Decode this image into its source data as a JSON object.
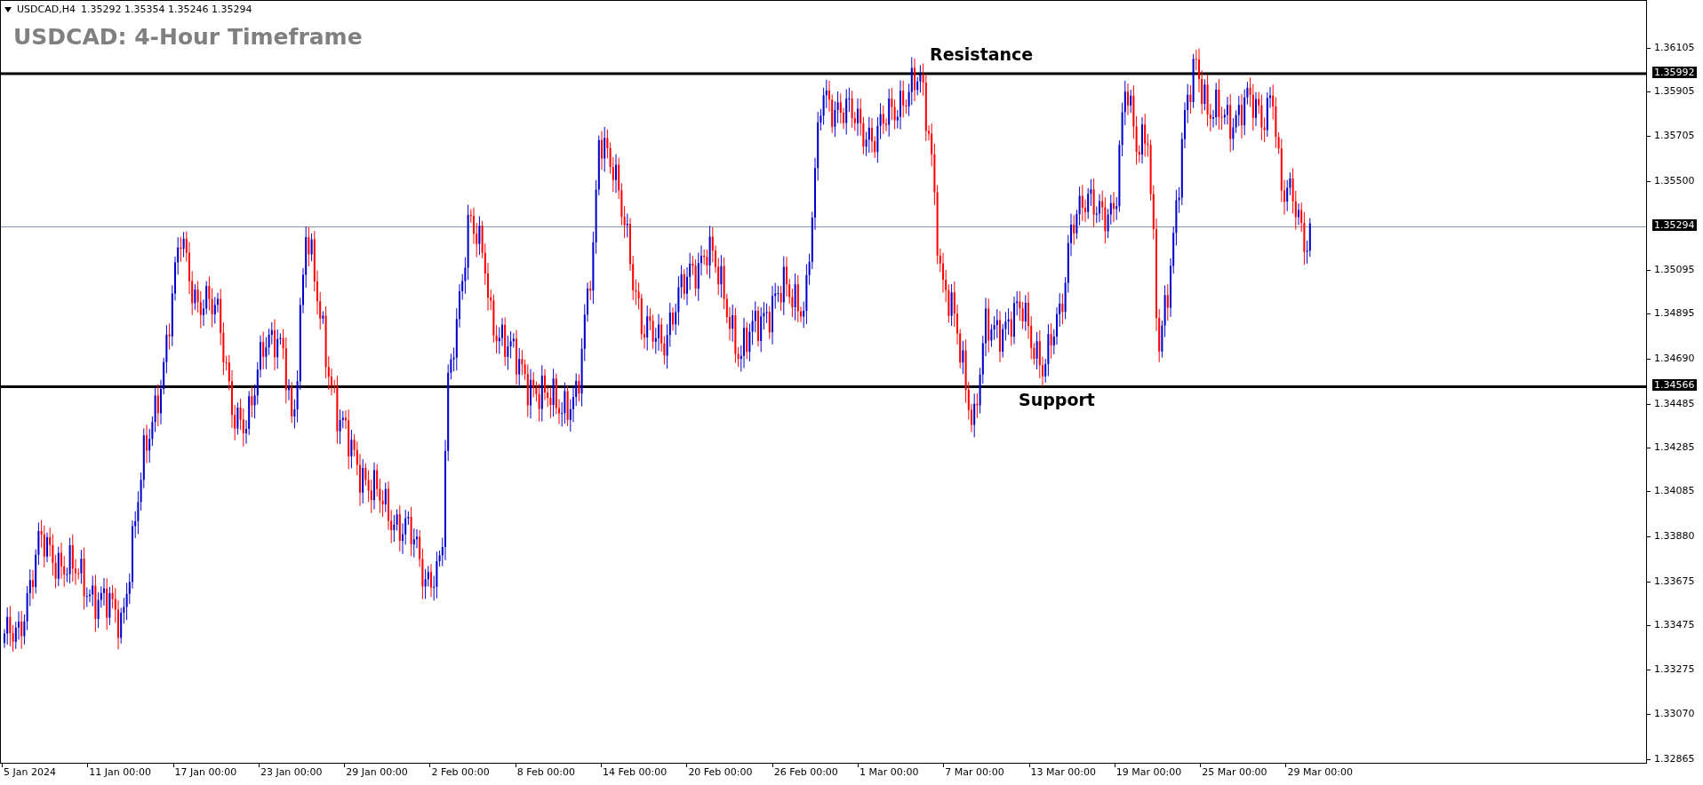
{
  "chart": {
    "symbol": "USDCAD,H4",
    "quotes": "1.35292 1.35354 1.35246 1.35294",
    "title": "USDCAD: 4-Hour Timeframe",
    "levels": [
      {
        "kind": "resistance",
        "label": "Resistance",
        "price": "1.35992"
      },
      {
        "kind": "current",
        "price": "1.35294"
      },
      {
        "kind": "support",
        "label": "Support",
        "price": "1.34566"
      }
    ],
    "price_axis": [
      "1.36105",
      "1.35905",
      "1.35705",
      "1.35500",
      "1.35095",
      "1.34895",
      "1.34690",
      "1.34485",
      "1.34285",
      "1.34085",
      "1.33880",
      "1.33675",
      "1.33475",
      "1.33275",
      "1.33070",
      "1.32865"
    ],
    "time_axis": [
      "5 Jan 2024",
      "11 Jan 00:00",
      "17 Jan 00:00",
      "23 Jan 00:00",
      "29 Jan 00:00",
      "2 Feb 00:00",
      "8 Feb 00:00",
      "14 Feb 00:00",
      "20 Feb 00:00",
      "26 Feb 00:00",
      "1 Mar 00:00",
      "7 Mar 00:00",
      "13 Mar 00:00",
      "19 Mar 00:00",
      "25 Mar 00:00",
      "29 Mar 00:00"
    ]
  }
}
